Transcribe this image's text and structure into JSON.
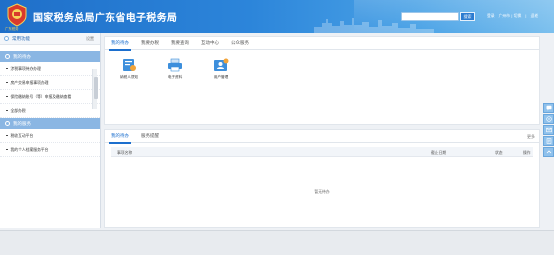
{
  "header": {
    "logo_text": "广东税务",
    "title": "国家税务总局广东省电子税务局",
    "search_placeholder": "",
    "search_button": "搜索",
    "links": [
      "登录",
      "广州市 | 切换",
      "|",
      "适老"
    ]
  },
  "sidebar": {
    "common_functions": {
      "label": "常用功能",
      "more": "设置"
    },
    "sections": [
      {
        "title": "我的待办",
        "items": [
          "涉税事项待办办理",
          "房产交易申报事项办理",
          "保险缴纳账号（等）申报及缴纳查看",
          "全部办税"
        ]
      },
      {
        "title": "我的服务",
        "items": [
          "税收互动平台",
          "我的个人档案服务平台"
        ]
      }
    ]
  },
  "main": {
    "tabs_top": [
      "我的待办",
      "我要办税",
      "我要查询",
      "互动中心",
      "公众服务"
    ],
    "tiles": [
      {
        "label": "纳税人须知",
        "icon": "notice-icon"
      },
      {
        "label": "电子资料",
        "icon": "printer-icon"
      },
      {
        "label": "用户管理",
        "icon": "user-manage-icon"
      }
    ],
    "tabs_bottom": [
      "我的待办",
      "服务提醒"
    ],
    "bottom_more": "更多",
    "table_headers": {
      "name": "事项名称",
      "deadline": "截止日期",
      "status": "状态",
      "action": "操作"
    },
    "empty_text": "暂无待办"
  },
  "float_buttons": [
    "chat-icon",
    "message-icon",
    "mail-icon",
    "form-icon",
    "up-icon"
  ],
  "colors": {
    "brand": "#1f6fc9",
    "accent": "#1c6fce",
    "section": "#8ab6e3"
  }
}
